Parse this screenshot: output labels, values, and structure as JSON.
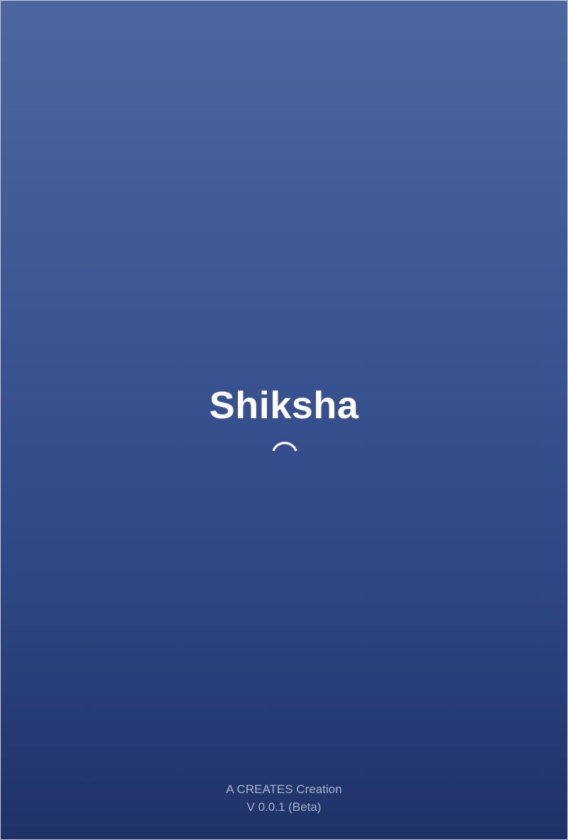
{
  "splash": {
    "app_name": "Shiksha",
    "loading_indicator": "spinner-icon",
    "footer": {
      "credit": "A CREATES Creation",
      "version": "V 0.0.1 (Beta)"
    }
  },
  "colors": {
    "gradient_top": "#4c67a0",
    "gradient_bottom": "#1f3268",
    "title_text": "#ffffff",
    "footer_text": "#a8b1c6",
    "spinner": "#ffffff"
  }
}
